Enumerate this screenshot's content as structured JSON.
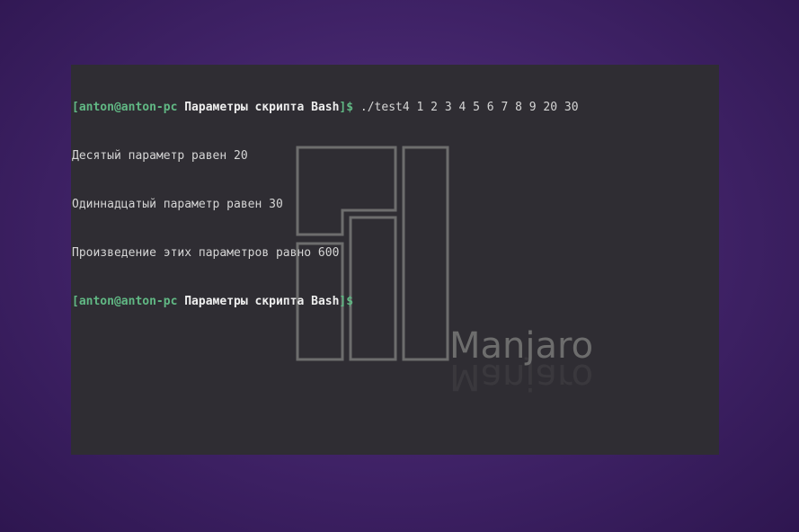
{
  "terminal": {
    "prompt": {
      "user_host": "[anton@anton-pc",
      "directory": "Параметры скрипта Bash",
      "suffix": "]$"
    },
    "command": "./test4 1 2 3 4 5 6 7 8 9 20 30",
    "output": [
      "Десятый параметр равен 20",
      "Одиннадцатый параметр равен 30",
      "Произведение этих параметров равно 600"
    ]
  },
  "wallpaper": {
    "logo_text": "Manjaro",
    "background_color": "#4a2a73",
    "terminal_color": "#2f2d33",
    "prompt_green": "#61b884"
  }
}
